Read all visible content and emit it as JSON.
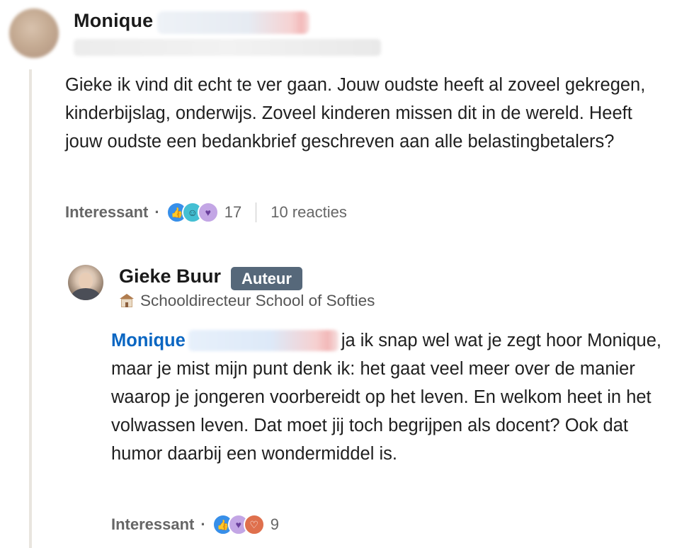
{
  "comment": {
    "author_first_name": "Monique",
    "body": "Gieke ik vind dit echt te ver gaan. Jouw oudste heeft al zoveel gekregen, kinderbijslag, onderwijs. Zoveel kinderen missen dit in de wereld. Heeft jouw oudste een bedankbrief geschreven aan alle belastingbetalers?",
    "reaction_label": "Interessant",
    "separator": "·",
    "reaction_icons": [
      "like-icon",
      "funny-icon",
      "support-icon"
    ],
    "reaction_count": "17",
    "replies_label": "10 reacties"
  },
  "reply": {
    "author_name": "Gieke Buur",
    "author_badge": "Auteur",
    "headline_icon": "school-icon",
    "headline": "Schooldirecteur School of Softies",
    "mention_first_name": "Monique",
    "body": "ja ik snap wel wat je zegt hoor Monique, maar je mist mijn punt denk ik: het gaat veel meer over de manier waarop je jongeren voorbereidt op het leven. En welkom heet in het volwassen leven. Dat moet jij toch begrijpen als docent? Ook dat humor daarbij een wondermiddel is.",
    "reaction_label": "Interessant",
    "separator": "·",
    "reaction_icons": [
      "like-icon",
      "support-icon",
      "love-icon"
    ],
    "reaction_count": "9"
  },
  "colors": {
    "link": "#0a66c2",
    "badge_bg": "#56687a",
    "thread_line": "#e9e5df",
    "like": "#378fe9",
    "funny": "#44bfd3",
    "support": "#c3a6e5",
    "love": "#df704d"
  }
}
